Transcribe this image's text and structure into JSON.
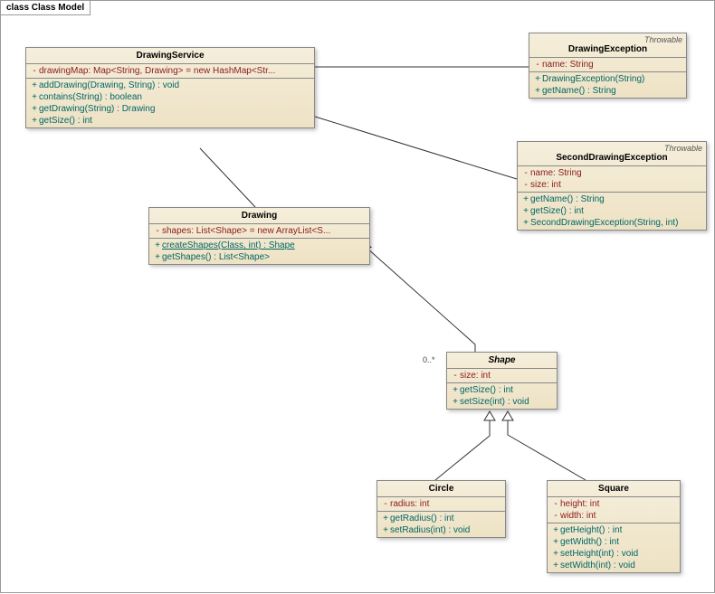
{
  "title": "class Class Model",
  "classes": {
    "drawingService": {
      "name": "DrawingService",
      "attrs": [
        {
          "vis": "-",
          "text": "drawingMap:  Map<String, Drawing> = new HashMap<Str..."
        }
      ],
      "ops": [
        {
          "vis": "+",
          "text": "addDrawing(Drawing, String) : void"
        },
        {
          "vis": "+",
          "text": "contains(String) : boolean"
        },
        {
          "vis": "+",
          "text": "getDrawing(String) : Drawing"
        },
        {
          "vis": "+",
          "text": "getSize() : int"
        }
      ]
    },
    "drawingException": {
      "name": "DrawingException",
      "stereotype": "Throwable",
      "attrs": [
        {
          "vis": "-",
          "text": "name:  String"
        }
      ],
      "ops": [
        {
          "vis": "+",
          "text": "DrawingException(String)"
        },
        {
          "vis": "+",
          "text": "getName() : String"
        }
      ]
    },
    "secondDrawingException": {
      "name": "SecondDrawingException",
      "stereotype": "Throwable",
      "attrs": [
        {
          "vis": "-",
          "text": "name:  String"
        },
        {
          "vis": "-",
          "text": "size:  int"
        }
      ],
      "ops": [
        {
          "vis": "+",
          "text": "getName() : String"
        },
        {
          "vis": "+",
          "text": "getSize() : int"
        },
        {
          "vis": "+",
          "text": "SecondDrawingException(String, int)"
        }
      ]
    },
    "drawing": {
      "name": "Drawing",
      "attrs": [
        {
          "vis": "-",
          "text": "shapes:  List<Shape> = new ArrayList<S..."
        }
      ],
      "ops": [
        {
          "vis": "+",
          "text": "createShapes(Class, int) : Shape",
          "static": true
        },
        {
          "vis": "+",
          "text": "getShapes() : List<Shape>"
        }
      ]
    },
    "shape": {
      "name": "Shape",
      "italic": true,
      "attrs": [
        {
          "vis": "-",
          "text": "size:  int"
        }
      ],
      "ops": [
        {
          "vis": "+",
          "text": "getSize() : int"
        },
        {
          "vis": "+",
          "text": "setSize(int) : void"
        }
      ]
    },
    "circle": {
      "name": "Circle",
      "attrs": [
        {
          "vis": "-",
          "text": "radius:  int"
        }
      ],
      "ops": [
        {
          "vis": "+",
          "text": "getRadius() : int"
        },
        {
          "vis": "+",
          "text": "setRadius(int) : void"
        }
      ]
    },
    "square": {
      "name": "Square",
      "attrs": [
        {
          "vis": "-",
          "text": "height:  int"
        },
        {
          "vis": "-",
          "text": "width:  int"
        }
      ],
      "ops": [
        {
          "vis": "+",
          "text": "getHeight() : int"
        },
        {
          "vis": "+",
          "text": "getWidth() : int"
        },
        {
          "vis": "+",
          "text": "setHeight(int) : void"
        },
        {
          "vis": "+",
          "text": "setWidth(int) : void"
        }
      ]
    }
  },
  "multiplicity": {
    "drawingShape": "0..*"
  }
}
